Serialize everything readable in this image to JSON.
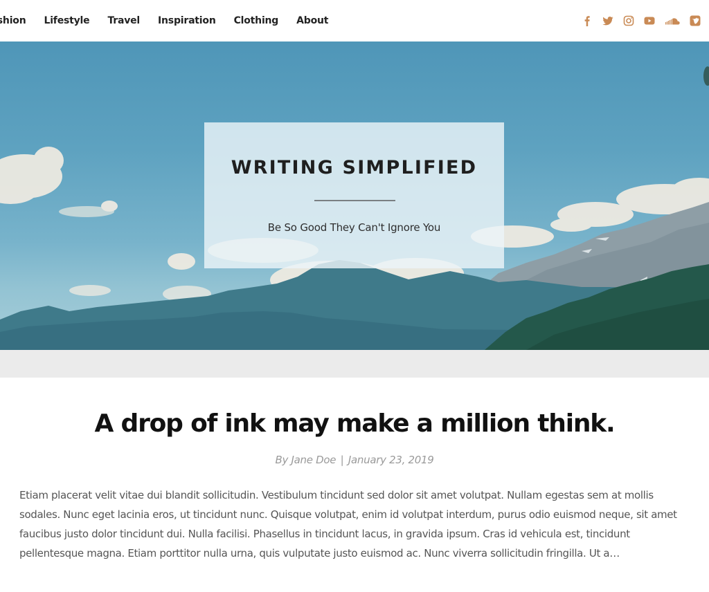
{
  "nav": {
    "items": [
      {
        "label": "Fashion"
      },
      {
        "label": "Lifestyle"
      },
      {
        "label": "Travel"
      },
      {
        "label": "Inspiration"
      },
      {
        "label": "Clothing"
      },
      {
        "label": "About"
      }
    ]
  },
  "social": {
    "color": "#c98a55",
    "icons": [
      {
        "name": "facebook-icon"
      },
      {
        "name": "twitter-icon"
      },
      {
        "name": "instagram-icon"
      },
      {
        "name": "youtube-icon"
      },
      {
        "name": "soundcloud-icon"
      },
      {
        "name": "vimeo-icon"
      }
    ]
  },
  "hero": {
    "title": "WRITING SIMPLIFIED",
    "tagline": "Be So Good They Can't Ignore You"
  },
  "post": {
    "title": "A drop of ink may make a million think.",
    "author": "By Jane Doe",
    "separator": "|",
    "date": "January 23, 2019",
    "excerpt": "Etiam placerat velit vitae dui blandit sollicitudin. Vestibulum tincidunt sed dolor sit amet volutpat. Nullam egestas sem at mollis sodales. Nunc eget lacinia eros, ut tincidunt nunc. Quisque volutpat, enim id volutpat interdum, purus odio euismod neque, sit amet faucibus justo dolor tincidunt dui. Nulla facilisi. Phasellus in tincidunt lacus, in gravida ipsum. Cras id vehicula est, tincidunt pellentesque magna. Etiam porttitor nulla urna, quis vulputate justo euismod ac. Nunc viverra sollicitudin fringilla. Ut a…"
  }
}
